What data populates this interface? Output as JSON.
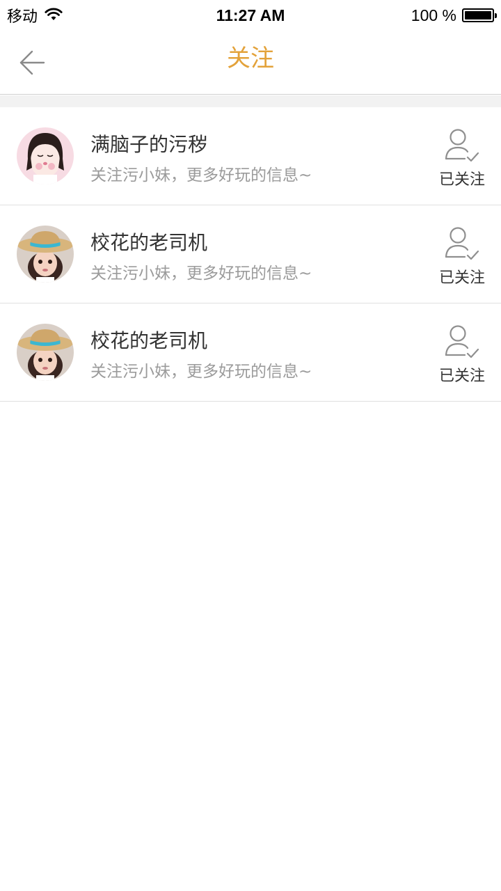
{
  "status_bar": {
    "carrier": "移动",
    "time": "11:27 AM",
    "battery_percent": "100 %",
    "battery_level": 1.0
  },
  "nav": {
    "title": "关注",
    "back_icon": "back-arrow-icon",
    "title_color": "#e3a23a"
  },
  "follow_list": [
    {
      "name": "满脑子的污秽",
      "description": "关注污小妹，更多好玩的信息~",
      "follow_status": "已关注",
      "avatar": "cartoon-girl-avatar"
    },
    {
      "name": "校花的老司机",
      "description": "关注污小妹，更多好玩的信息~",
      "follow_status": "已关注",
      "avatar": "child-straw-hat-avatar"
    },
    {
      "name": "校花的老司机",
      "description": "关注污小妹，更多好玩的信息~",
      "follow_status": "已关注",
      "avatar": "child-straw-hat-avatar"
    }
  ]
}
